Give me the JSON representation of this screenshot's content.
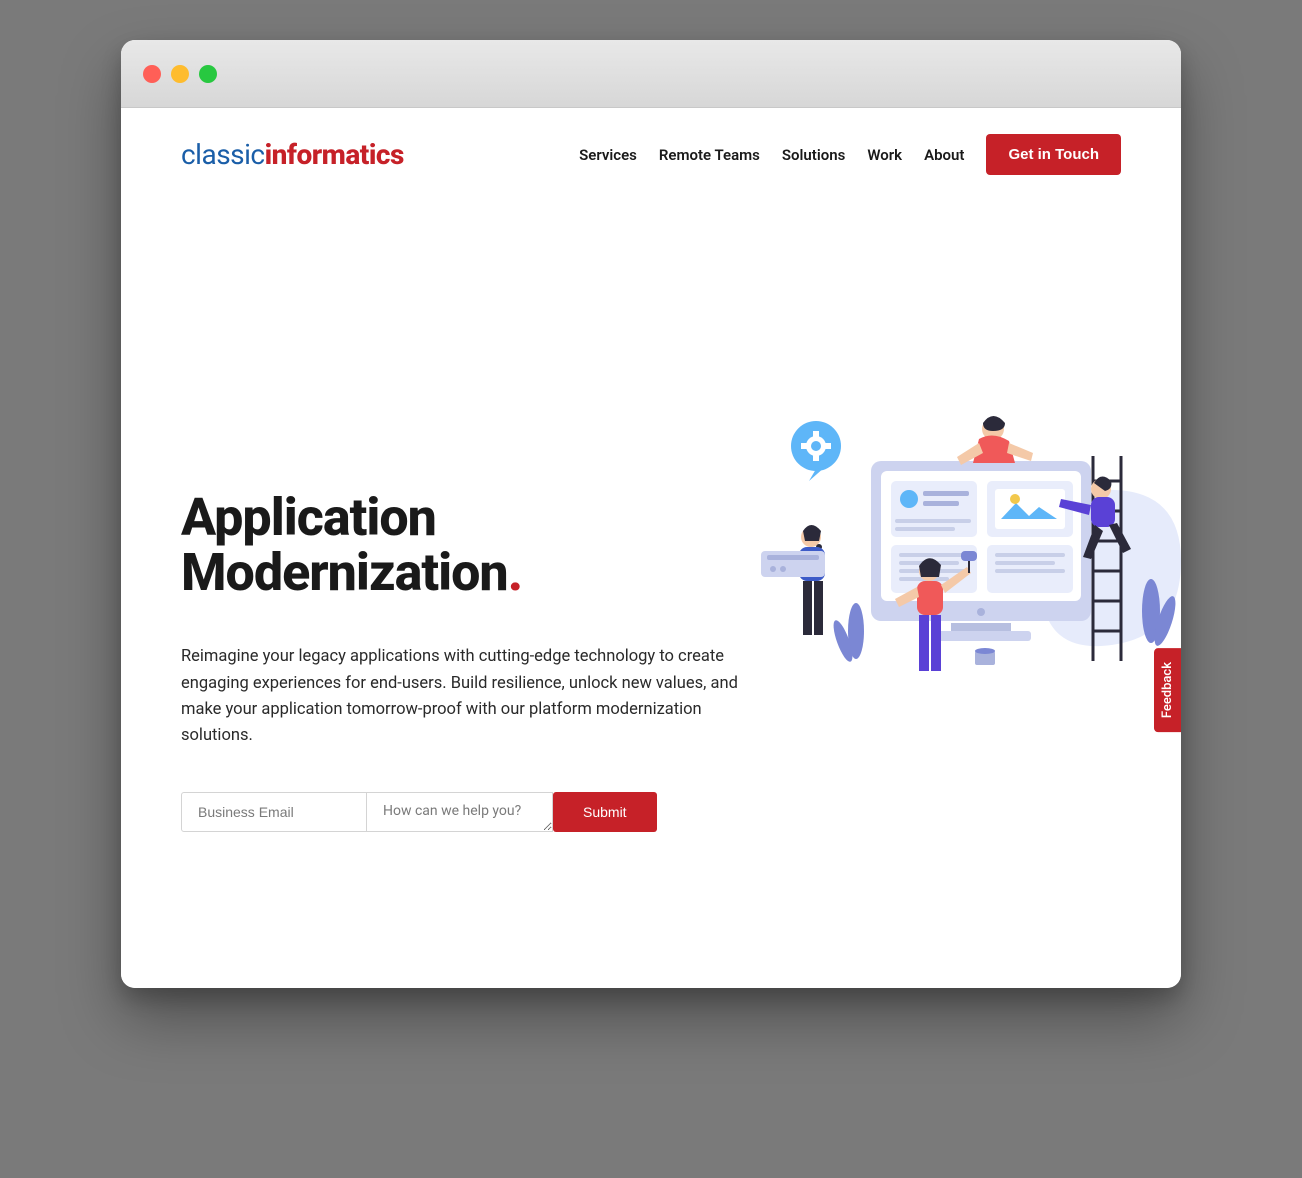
{
  "logo": {
    "part1": "classic",
    "part2": "informatics"
  },
  "nav": {
    "items": [
      "Services",
      "Remote Teams",
      "Solutions",
      "Work",
      "About"
    ],
    "cta": "Get in Touch"
  },
  "hero": {
    "title": "Application Modernization",
    "dot": ".",
    "description": "Reimagine your legacy applications with cutting-edge technology to create engaging experiences for end-users. Build resilience, unlock new values, and make your application tomorrow-proof with our platform modernization solutions."
  },
  "form": {
    "email_placeholder": "Business Email",
    "message_placeholder": "How can we help you?",
    "submit_label": "Submit"
  },
  "feedback": {
    "label": "Feedback"
  }
}
